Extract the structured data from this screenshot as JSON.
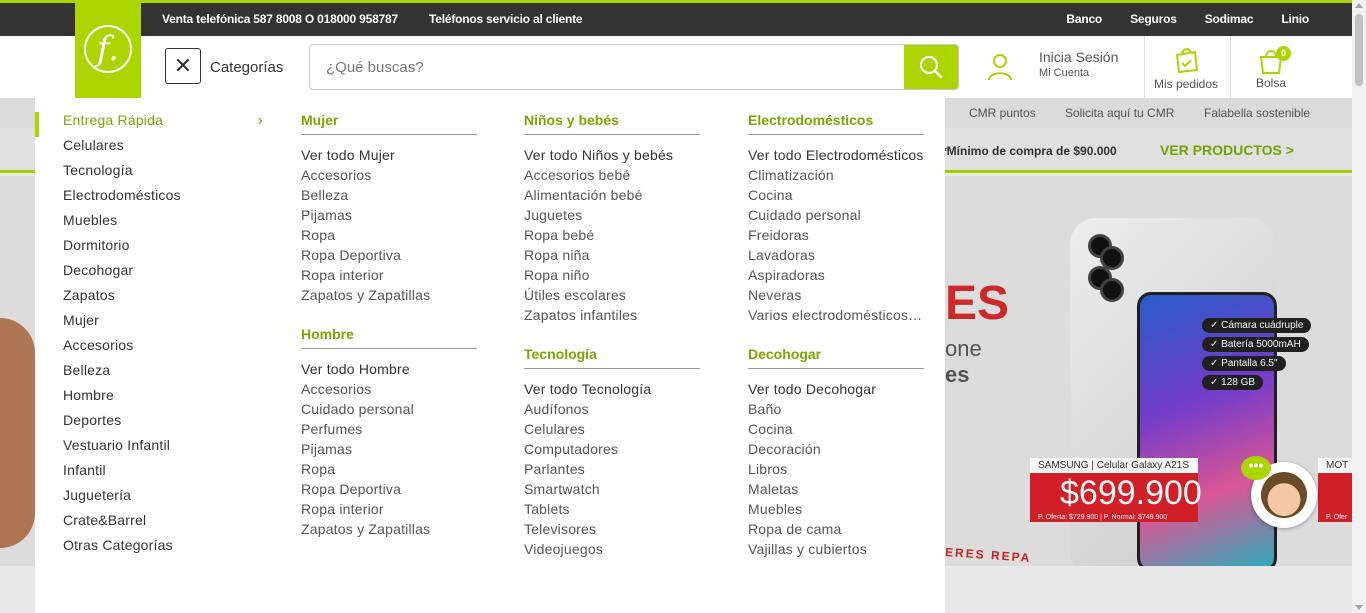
{
  "topbar": {
    "phone": "Venta telefónica 587 8008 O 018000 958787",
    "service": "Teléfonos servicio al cliente",
    "links": [
      "Banco",
      "Seguros",
      "Sodimac",
      "Linio"
    ]
  },
  "header": {
    "logo_letter": "f.",
    "categories_label": "Categorías",
    "search_placeholder": "¿Qué buscas?",
    "login_title": "Inicia Sesión",
    "login_sub": "Mi Cuenta",
    "orders_label": "Mis pedidos",
    "bag_label": "Bolsa",
    "bag_count": "0"
  },
  "subnav": [
    "CMR puntos",
    "Solicita aquí tu CMR",
    "Falabella sostenible"
  ],
  "promo": {
    "min_text": "*Mínimo de compra de $90.000",
    "cta": "VER PRODUCTOS >"
  },
  "hero": {
    "big": "ES",
    "line1": "one",
    "line2": "es",
    "strip": "ERES REPA",
    "specs": [
      "Cámara cuádruple",
      "Batería 5000mAH",
      "Pantalla 6.5\"",
      "128 GB"
    ],
    "product": "SAMSUNG | Celular Galaxy A21S",
    "price": "$699.900",
    "price_small": "P. Oferta: $729.900 | P. Normal: $749.900",
    "next_product": "MOT",
    "next_price_small": "P. Ofer"
  },
  "chat_bubble": "•••",
  "menu": {
    "left": [
      "Entrega Rápida",
      "Celulares",
      "Tecnología",
      "Electrodomésticos",
      "Muebles",
      "Dormitorio",
      "Decohogar",
      "Zapatos",
      "Mujer",
      "Accesorios",
      "Belleza",
      "Hombre",
      "Deportes",
      "Vestuario Infantil",
      "Infantil",
      "Juguetería",
      "Crate&Barrel",
      "Otras Categorías"
    ],
    "col1": {
      "sections": [
        {
          "title": "Mujer",
          "items": [
            "Ver todo Mujer",
            "Accesorios",
            "Belleza",
            "Pijamas",
            "Ropa",
            "Ropa Deportiva",
            "Ropa interior",
            "Zapatos y Zapatillas"
          ]
        },
        {
          "title": "Hombre",
          "items": [
            "Ver todo Hombre",
            "Accesorios",
            "Cuidado personal",
            "Perfumes",
            "Pijamas",
            "Ropa",
            "Ropa Deportiva",
            "Ropa interior",
            "Zapatos y Zapatillas"
          ]
        }
      ]
    },
    "col2": {
      "sections": [
        {
          "title": "Niños y bebés",
          "items": [
            "Ver todo Niños y bebés",
            "Accesorios bebé",
            "Alimentación bebé",
            "Juguetes",
            "Ropa bebé",
            "Ropa niña",
            "Ropa niño",
            "Útiles escolares",
            "Zapatos infantiles"
          ]
        },
        {
          "title": "Tecnología",
          "items": [
            "Ver todo Tecnología",
            "Audífonos",
            "Celulares",
            "Computadores",
            "Parlantes",
            "Smartwatch",
            "Tablets",
            "Televisores",
            "Videojuegos"
          ]
        }
      ]
    },
    "col3": {
      "sections": [
        {
          "title": "Electrodomésticos",
          "items": [
            "Ver todo Electrodomésticos",
            "Climatización",
            "Cocina",
            "Cuidado personal",
            "Freidoras",
            "Lavadoras",
            "Aspiradoras",
            "Neveras",
            "Varios electrodomésticos ..."
          ]
        },
        {
          "title": "Decohogar",
          "items": [
            "Ver todo Decohogar",
            "Baño",
            "Cocina",
            "Decoración",
            "Libros",
            "Maletas",
            "Muebles",
            "Ropa de cama",
            "Vajillas y cubiertos"
          ]
        }
      ]
    }
  },
  "colors": {
    "accent": "#aad500",
    "accent_text": "#7ba600",
    "topbar": "#333333"
  }
}
